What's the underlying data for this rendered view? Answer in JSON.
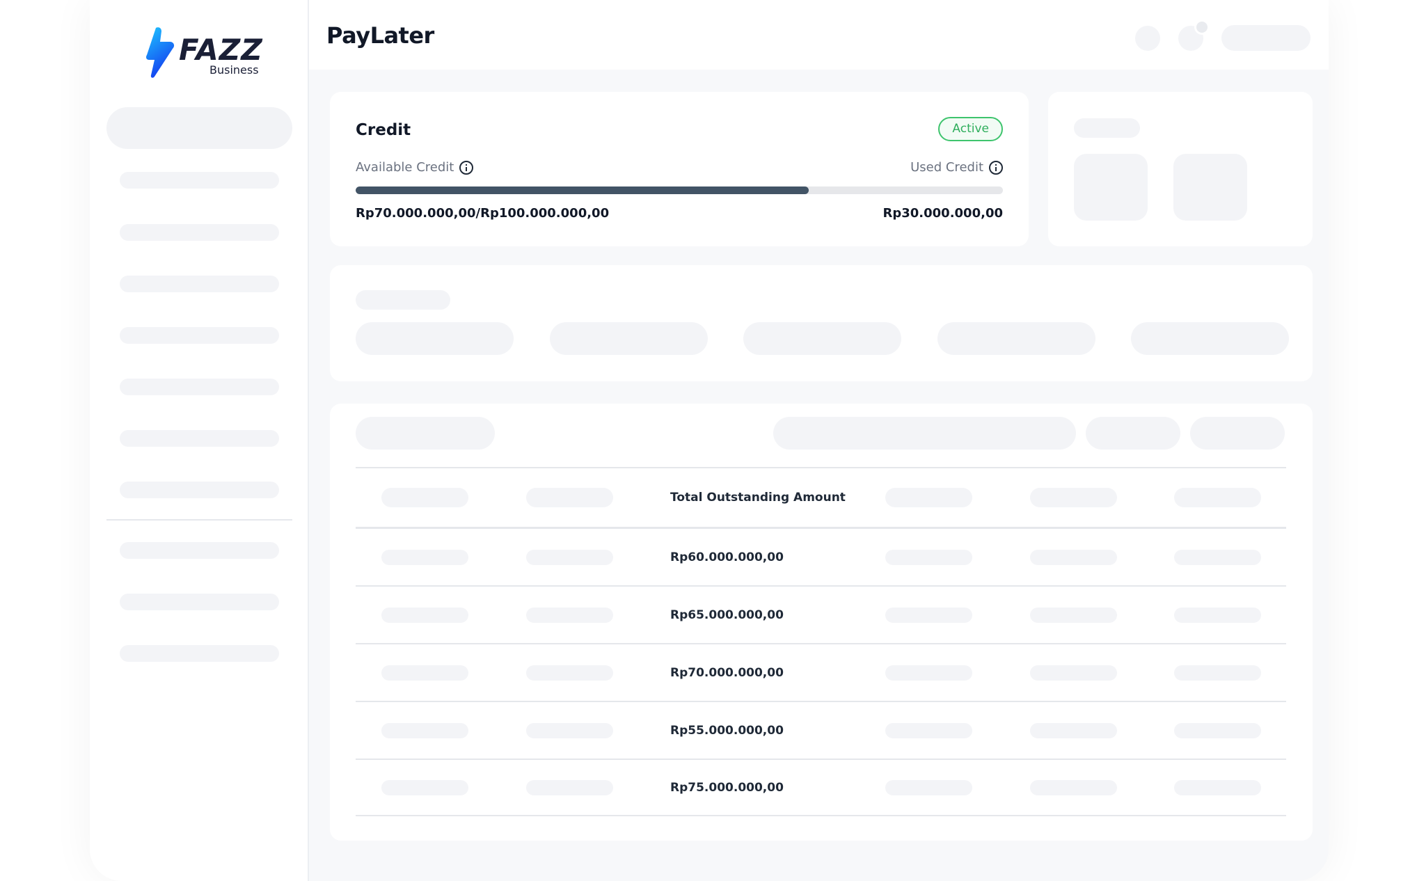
{
  "brand": {
    "name": "FAZZ",
    "subtitle": "Business",
    "colors": {
      "bolt_top": "#1ec7ff",
      "bolt_bottom": "#1440f0",
      "text": "#1a1f36"
    }
  },
  "header": {
    "title": "PayLater"
  },
  "credit": {
    "title": "Credit",
    "status": "Active",
    "available_label": "Available Credit",
    "used_label": "Used Credit",
    "available_amount": "Rp70.000.000,00/Rp100.000.000,00",
    "used_amount": "Rp30.000.000,00",
    "available_fraction": 0.7,
    "colors": {
      "bar_fill": "#425466",
      "bar_track": "#e6e7ea",
      "status": "#2fae5c"
    }
  },
  "table": {
    "column_header": "Total Outstanding Amount",
    "rows": [
      {
        "amount": "Rp60.000.000,00"
      },
      {
        "amount": "Rp65.000.000,00"
      },
      {
        "amount": "Rp70.000.000,00"
      },
      {
        "amount": "Rp55.000.000,00"
      },
      {
        "amount": "Rp75.000.000,00"
      }
    ]
  },
  "icons": {
    "logo": "fazz-bolt-icon",
    "info": "info-icon"
  }
}
